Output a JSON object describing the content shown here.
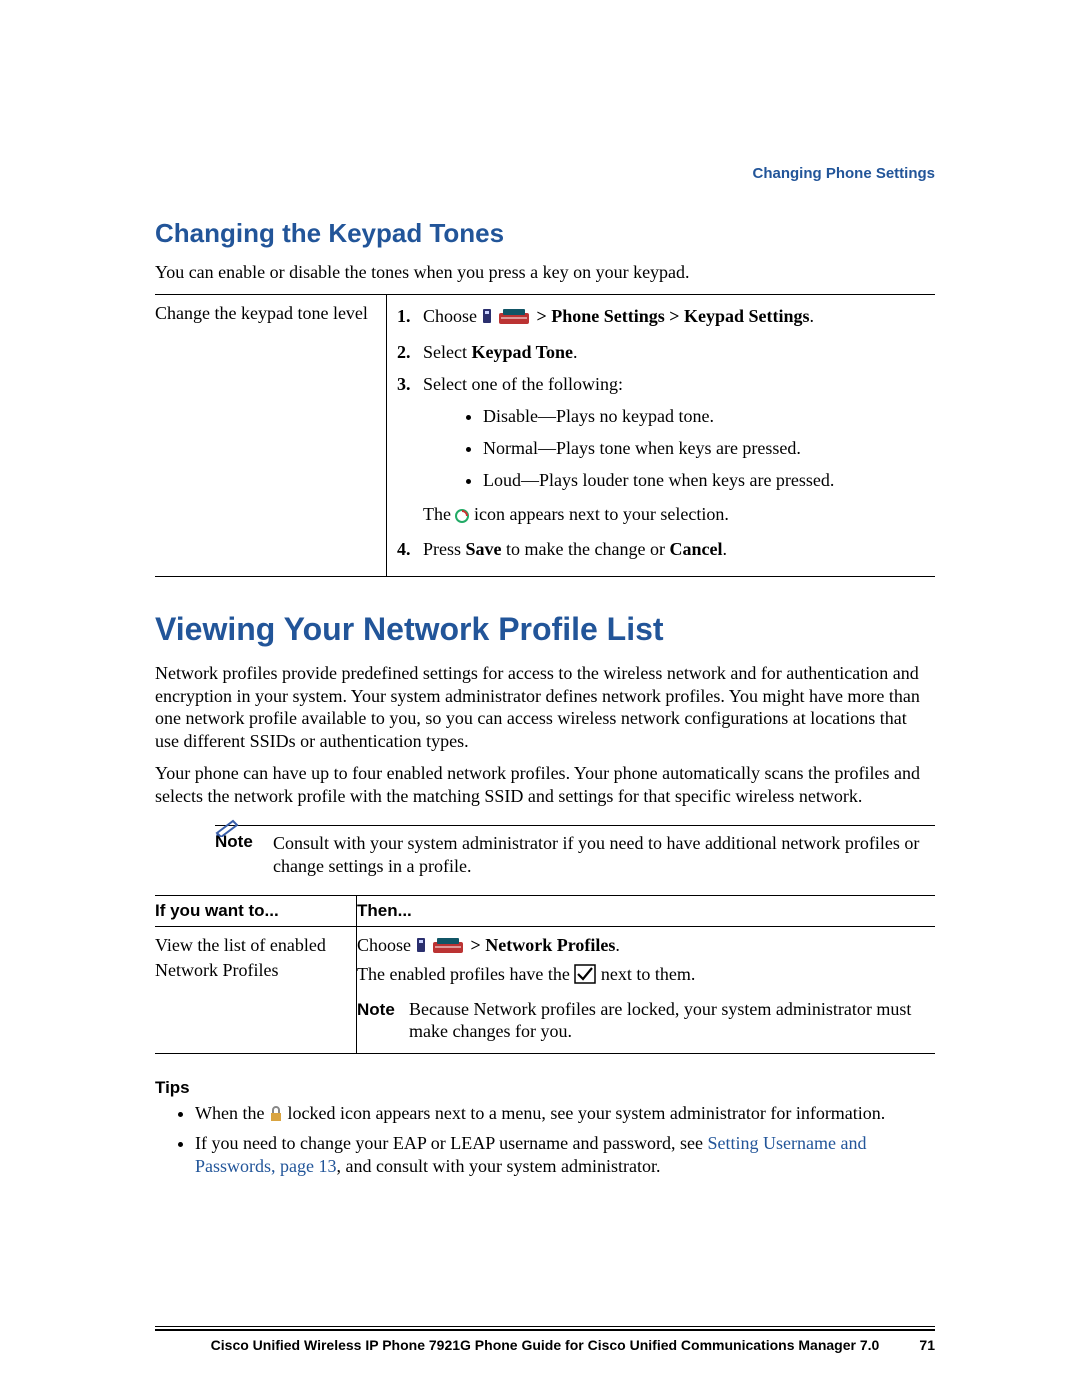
{
  "running_head": "Changing Phone Settings",
  "section1": {
    "heading": "Changing the Keypad Tones",
    "intro": "You can enable or disable the tones when you press a key on your keypad.",
    "row_label": "Change the keypad tone level",
    "step1_pre": "Choose ",
    "step1_post": " > Phone Settings > Keypad Settings",
    "period": ".",
    "step2_pre": "Select ",
    "step2_bold": "Keypad Tone",
    "step3": "Select one of the following:",
    "opt1": "Disable—Plays no keypad tone.",
    "opt2": "Normal—Plays tone when keys are pressed.",
    "opt3": "Loud—Plays louder tone when keys are pressed.",
    "step3_aux_pre": "The ",
    "step3_aux_post": " icon appears next to your selection.",
    "step4_pre": "Press ",
    "step4_b1": "Save",
    "step4_mid": " to make the change or ",
    "step4_b2": "Cancel",
    "step4_post": "."
  },
  "section2": {
    "heading": "Viewing Your Network Profile List",
    "para1": "Network profiles provide predefined settings for access to the wireless network and for authentication and encryption in your system. Your system administrator defines network profiles. You might have more than one network profile available to you, so you can access wireless network configurations at locations that use different SSIDs or authentication types.",
    "para2": "Your phone can have up to four enabled network profiles. Your phone automatically scans the profiles and selects the network profile with the matching SSID and settings for that specific wireless network.",
    "note_label": "Note",
    "note_text": "Consult with your system administrator if you need to have additional network profiles or change settings in a profile.",
    "th1": "If you want to...",
    "th2": "Then...",
    "td_left": "View the list of enabled Network Profiles",
    "td_right_l1_pre": "Choose ",
    "td_right_l1_bold": " > Network Profiles",
    "td_right_l2_pre": "The enabled profiles have the ",
    "td_right_l2_post": " next to them.",
    "inner_note": "Because Network profiles are locked, your system administrator must make changes for you.",
    "tips_head": "Tips",
    "tip1_pre": "When the ",
    "tip1_post": " locked icon appears next to a menu, see your system administrator for information.",
    "tip2_pre": "If you need to change your EAP or LEAP username and password, see ",
    "tip2_link": "Setting Username and Passwords, page 13",
    "tip2_post": ", and consult with your system administrator."
  },
  "footer": {
    "title": "Cisco Unified Wireless IP Phone 7921G Phone Guide for Cisco Unified Communications Manager 7.0",
    "page": "71"
  }
}
